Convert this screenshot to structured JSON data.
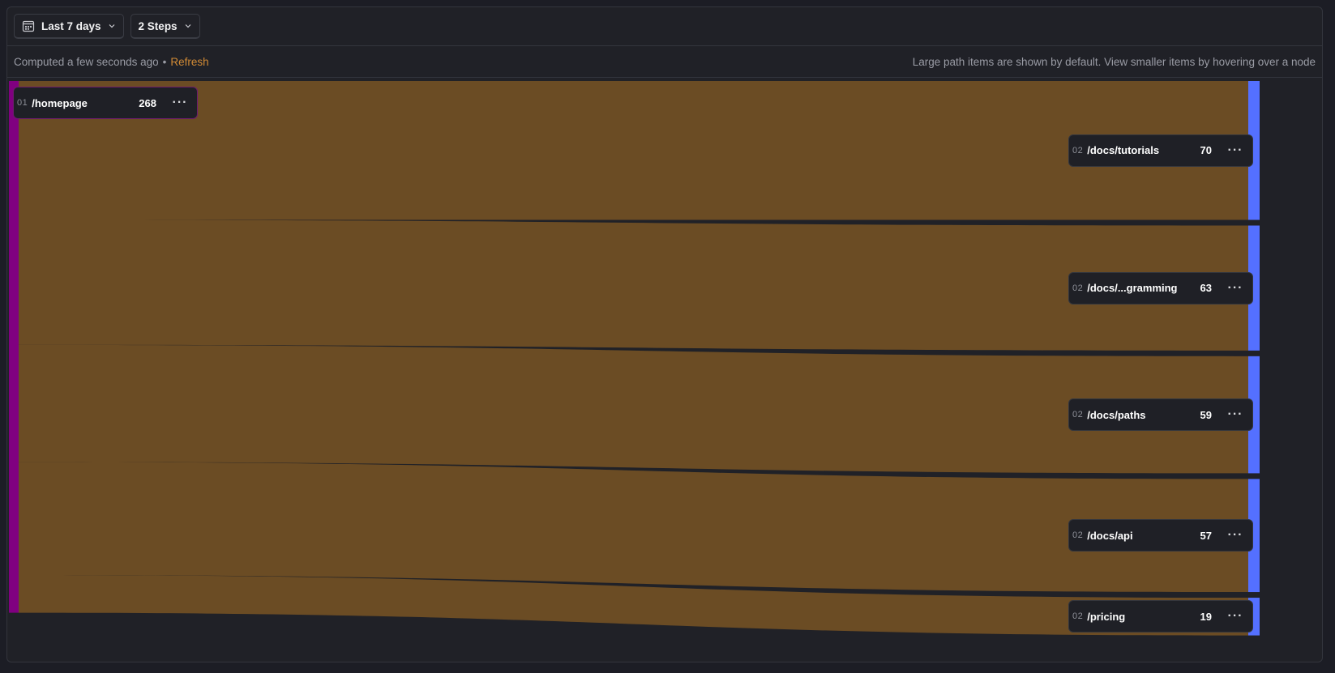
{
  "toolbar": {
    "date_range_label": "Last 7 days",
    "date_range_icon": "calendar-icon",
    "steps_label": "2 Steps",
    "chevron_icon": "chevron-down-icon"
  },
  "info": {
    "computed_text": "Computed a few seconds ago",
    "separator": "•",
    "refresh_label": "Refresh",
    "hint_text": "Large path items are shown by default. View smaller items by hovering over a node"
  },
  "colors": {
    "source_node": "#800080",
    "target_node": "#5470ff",
    "link": "#6b4c24",
    "refresh": "#d18a35"
  },
  "chart_data": {
    "type": "sankey",
    "title": "",
    "source": {
      "step": "01",
      "name": "/homepage",
      "value": 268
    },
    "targets": [
      {
        "step": "02",
        "name": "/docs/tutorials",
        "value": 70
      },
      {
        "step": "02",
        "name": "/docs/...gramming",
        "value": 63
      },
      {
        "step": "02",
        "name": "/docs/paths",
        "value": 59
      },
      {
        "step": "02",
        "name": "/docs/api",
        "value": 57
      },
      {
        "step": "02",
        "name": "/pricing",
        "value": 19
      }
    ],
    "links": [
      {
        "source": "/homepage",
        "target": "/docs/tutorials",
        "value": 70
      },
      {
        "source": "/homepage",
        "target": "/docs/...gramming",
        "value": 63
      },
      {
        "source": "/homepage",
        "target": "/docs/paths",
        "value": 59
      },
      {
        "source": "/homepage",
        "target": "/docs/api",
        "value": 57
      },
      {
        "source": "/homepage",
        "target": "/pricing",
        "value": 19
      }
    ],
    "more_icon": "more-horizontal-icon"
  }
}
